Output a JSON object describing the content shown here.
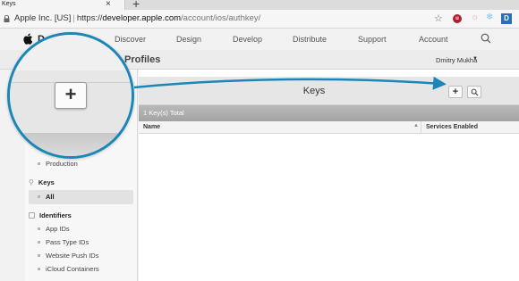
{
  "browser": {
    "tab_title": "Keys",
    "tab_close": "×",
    "new_tab": "+",
    "address_prefix": "Apple Inc. [US]",
    "address_separator": "|",
    "address_scheme": "https://",
    "address_host": "developer.apple.com",
    "address_path": "/account/ios/authkey/",
    "bookmark_icon": "☆",
    "extensions": [
      "u",
      "☼",
      "❄",
      "D"
    ]
  },
  "site_nav": {
    "brand_partial": "D",
    "links": [
      "Discover",
      "Design",
      "Develop",
      "Distribute",
      "Support",
      "Account"
    ]
  },
  "header": {
    "section_title": "& Profiles",
    "user_name": "Dmitry Mukha",
    "user_caret": "▼"
  },
  "sidebar": {
    "production": "Production",
    "keys_heading": "Keys",
    "keys_all": "All",
    "identifiers_heading": "Identifiers",
    "identifier_items": [
      "App IDs",
      "Pass Type IDs",
      "Website Push IDs",
      "iCloud Containers"
    ]
  },
  "main": {
    "page_title": "Keys",
    "add_label": "+",
    "search_label": "🔍",
    "count_text": "1 Key(s) Total",
    "col_name": "Name",
    "col_sort": "▲",
    "col_services": "Services Enabled"
  },
  "callout": {
    "button_label": "+",
    "color": "#1b86b8"
  }
}
